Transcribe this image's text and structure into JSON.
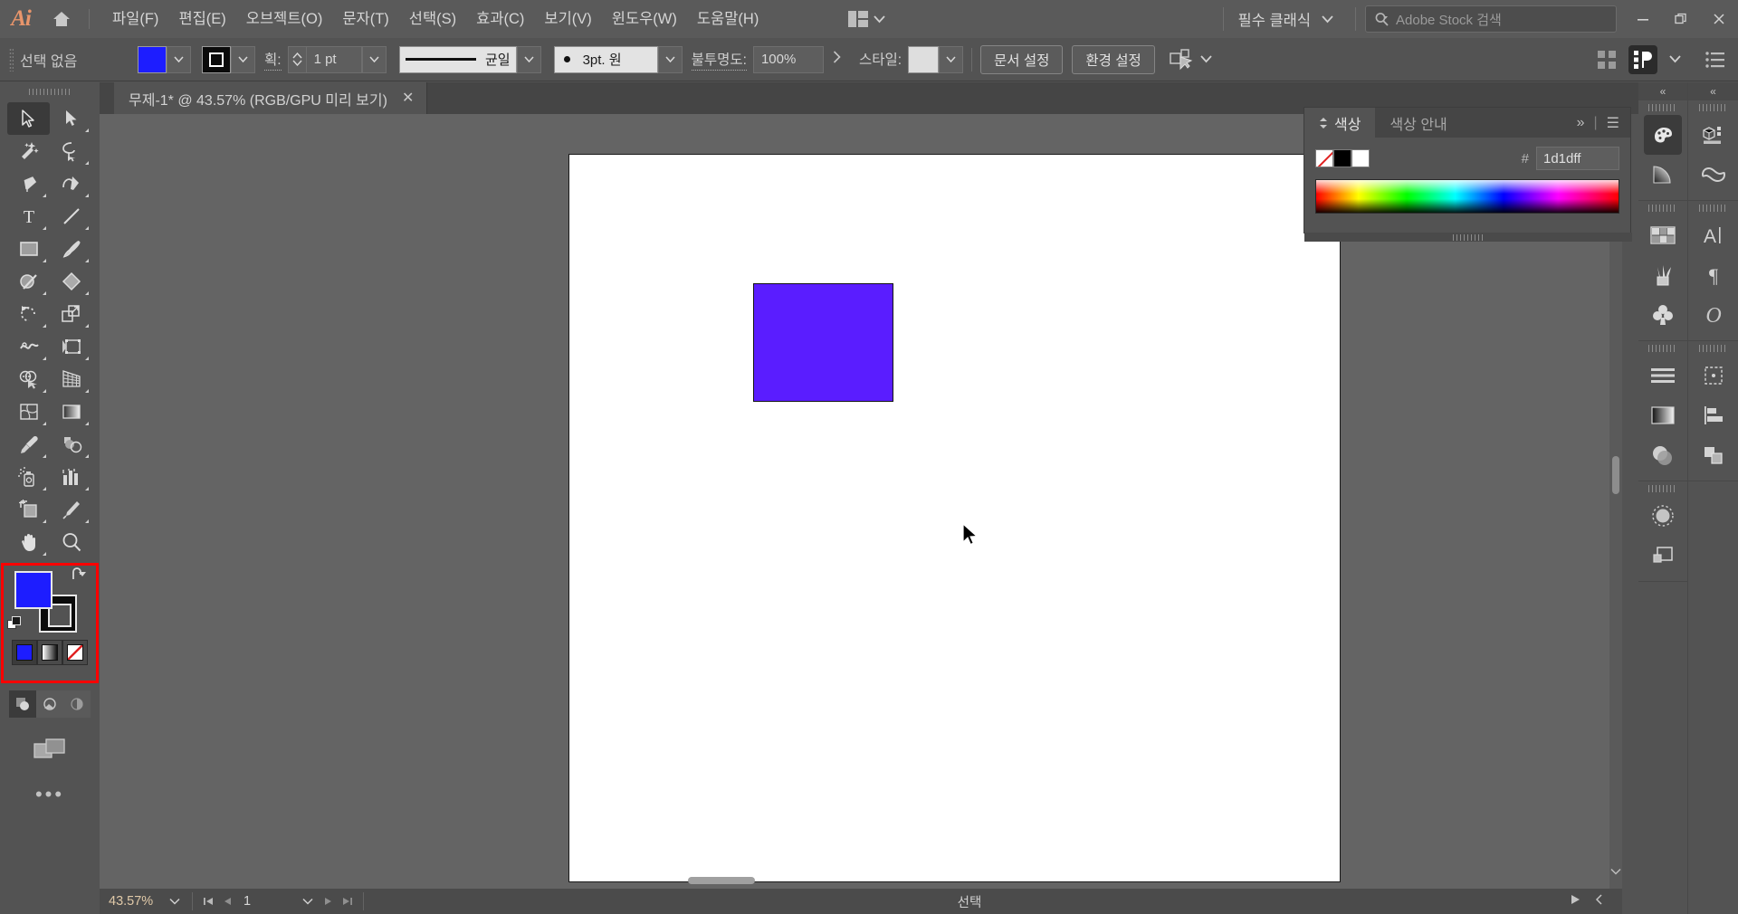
{
  "app": {
    "logo_text": "Ai",
    "home_icon": "home-icon"
  },
  "menubar": {
    "items": [
      {
        "label": "파일(F)"
      },
      {
        "label": "편집(E)"
      },
      {
        "label": "오브젝트(O)"
      },
      {
        "label": "문자(T)"
      },
      {
        "label": "선택(S)"
      },
      {
        "label": "효과(C)"
      },
      {
        "label": "보기(V)"
      },
      {
        "label": "윈도우(W)"
      },
      {
        "label": "도움말(H)"
      }
    ],
    "workspace": "필수 클래식",
    "search_placeholder": "Adobe Stock 검색",
    "window_minimize": "−",
    "window_maximize": "❐",
    "window_close": "✕"
  },
  "controlbar": {
    "selection_label": "선택 없음",
    "fill_color": "#1d1dff",
    "stroke_color": "#0b0b0b",
    "stroke_label": "획:",
    "stroke_weight": "1 pt",
    "profile_label": "균일",
    "cap_label": "3pt. 원",
    "opacity_label": "불투명도:",
    "opacity_value": "100%",
    "style_label": "스타일:",
    "doc_setup_button": "문서 설정",
    "preferences_button": "환경 설정"
  },
  "tabbar": {
    "document_title": "무제-1* @ 43.57% (RGB/GPU 미리 보기)",
    "close_glyph": "✕"
  },
  "toolbar": {
    "tools": [
      {
        "name": "selection-tool",
        "selected": true
      },
      {
        "name": "direct-selection-tool",
        "selected": false
      },
      {
        "name": "magic-wand-tool",
        "selected": false
      },
      {
        "name": "lasso-tool",
        "selected": false
      },
      {
        "name": "pen-tool",
        "selected": false
      },
      {
        "name": "curvature-tool",
        "selected": false
      },
      {
        "name": "type-tool",
        "selected": false
      },
      {
        "name": "line-segment-tool",
        "selected": false
      },
      {
        "name": "rectangle-tool",
        "selected": false
      },
      {
        "name": "paintbrush-tool",
        "selected": false
      },
      {
        "name": "shaper-tool",
        "selected": false
      },
      {
        "name": "eraser-tool",
        "selected": false
      },
      {
        "name": "rotate-tool",
        "selected": false
      },
      {
        "name": "scale-tool",
        "selected": false
      },
      {
        "name": "width-tool",
        "selected": false
      },
      {
        "name": "free-transform-tool",
        "selected": false
      },
      {
        "name": "shape-builder-tool",
        "selected": false
      },
      {
        "name": "perspective-grid-tool",
        "selected": false
      },
      {
        "name": "mesh-tool",
        "selected": false
      },
      {
        "name": "gradient-tool",
        "selected": false
      },
      {
        "name": "eyedropper-tool",
        "selected": false
      },
      {
        "name": "blend-tool",
        "selected": false
      },
      {
        "name": "symbol-sprayer-tool",
        "selected": false
      },
      {
        "name": "column-graph-tool",
        "selected": false
      },
      {
        "name": "artboard-tool",
        "selected": false
      },
      {
        "name": "slice-tool",
        "selected": false
      },
      {
        "name": "hand-tool",
        "selected": false
      },
      {
        "name": "zoom-tool",
        "selected": false
      }
    ],
    "fill_color": "#1d1dff",
    "stroke_color": "#000000",
    "more_tools_glyph": "•••"
  },
  "canvas": {
    "background_color": "#646464",
    "artboard_color": "#ffffff",
    "shape": {
      "name": "rectangle-shape",
      "fill_color": "#5a1dff",
      "stroke_color": "#141414"
    }
  },
  "colorpanel": {
    "tabs": [
      {
        "label": "색상",
        "active": true
      },
      {
        "label": "색상 안내",
        "active": false
      }
    ],
    "expand_glyph": "»",
    "menu_glyph": "☰",
    "hash_label": "#",
    "hex_value": "1d1dff",
    "swatch_none": "none-swatch",
    "swatch_black": "#000000",
    "swatch_white": "#ffffff"
  },
  "rightdock": {
    "collapse_glyph": "«",
    "items_left": [
      {
        "name": "swatches-panel-icon",
        "active": true
      },
      {
        "name": "gradient-panel-icon",
        "active": false
      },
      {
        "name": "color-swatches-grid-icon",
        "active": false
      },
      {
        "name": "brushes-panel-icon",
        "active": false
      },
      {
        "name": "symbols-panel-icon",
        "active": false
      },
      {
        "name": "stroke-panel-icon",
        "active": false
      },
      {
        "name": "gradient-bar-icon",
        "active": false
      },
      {
        "name": "transparency-panel-icon",
        "active": false
      },
      {
        "name": "appearance-panel-icon",
        "active": false
      },
      {
        "name": "layers-thumbnail-icon",
        "active": false
      }
    ],
    "items_right": [
      {
        "name": "asset-export-panel-icon",
        "active": false
      },
      {
        "name": "creative-cloud-libraries-icon",
        "active": false
      },
      {
        "name": "character-panel-icon",
        "active": false
      },
      {
        "name": "paragraph-panel-icon",
        "active": false
      },
      {
        "name": "glyphs-panel-icon",
        "active": false
      },
      {
        "name": "artboards-panel-icon",
        "active": false
      },
      {
        "name": "align-panel-icon",
        "active": false
      },
      {
        "name": "pathfinder-panel-icon",
        "active": false
      }
    ]
  },
  "statusbar": {
    "zoom_value": "43.57%",
    "page_value": "1",
    "status_text": "선택",
    "first_glyph": "⏮",
    "prev_glyph": "◀",
    "next_glyph": "▶",
    "last_glyph": "⏭",
    "play_glyph": "▶",
    "chevron_glyph": "❮"
  }
}
